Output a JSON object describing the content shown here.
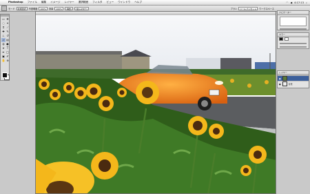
{
  "menubar": {
    "apple_glyph": "",
    "app_name": "Photoshop",
    "items": [
      "ファイル",
      "編集",
      "イメージ",
      "レイヤー",
      "選択範囲",
      "フィルタ",
      "ビュー",
      "ウインドウ",
      "ヘルプ"
    ],
    "clock": "4:17:13"
  },
  "optionsbar": {
    "label1": "モード",
    "field1": "新規選択",
    "label2": "不透明度",
    "field2": "100%",
    "label3": "流量",
    "field3": "100%",
    "button1": "消去",
    "button2": "全レイヤー",
    "label4": "ブラシ",
    "field4": "ツールプリセット",
    "label5": "ワークスペース"
  },
  "document": {
    "title": "",
    "photo_description_colors": {
      "sky": "#f2f3f6",
      "car": "#f07f1c",
      "foliage": "#2f5d1a",
      "petal": "#f4b71b"
    }
  },
  "panels": {
    "navigator": {
      "tab": "ナビゲーター"
    },
    "color": {
      "tab": "カラー"
    },
    "layers": {
      "tab": "レイヤー",
      "items": [
        "",
        "背景"
      ]
    }
  }
}
